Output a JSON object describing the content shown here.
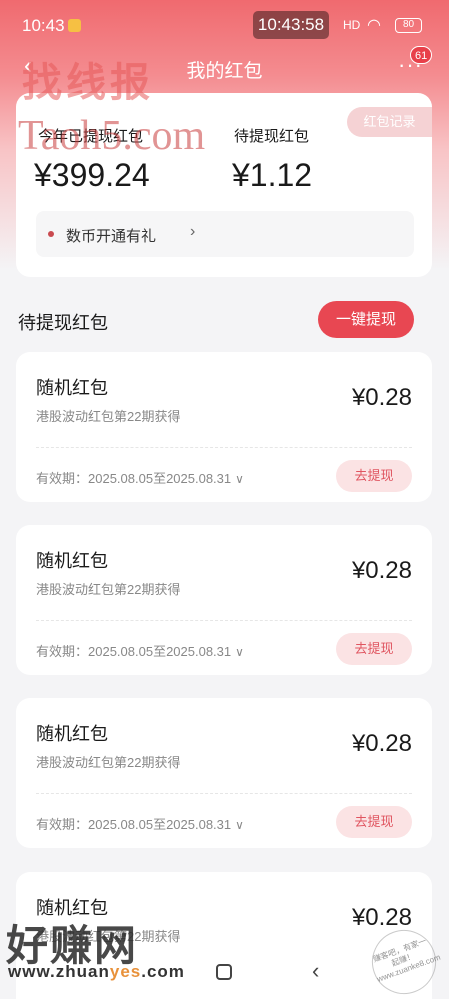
{
  "status_bar": {
    "time_left": "10:43",
    "clock": "10:43:58",
    "signal": "HD",
    "battery": "80"
  },
  "header": {
    "title": "我的红包",
    "badge_count": "61"
  },
  "summary": {
    "record_button": "红包记录",
    "withdrawn_label": "今年已提现红包",
    "withdrawn_amount": "¥399.24",
    "pending_label": "待提现红包",
    "pending_amount": "¥1.12",
    "promo_text": "数币开通有礼",
    "promo_chevron": "›"
  },
  "pending_section": {
    "title": "待提现红包",
    "one_click_button": "一键提现"
  },
  "packets": [
    {
      "title": "随机红包",
      "source": "港股波动红包第22期获得",
      "amount": "¥0.28",
      "validity": "有效期：2025.08.05至2025.08.31",
      "button": "去提现"
    },
    {
      "title": "随机红包",
      "source": "港股波动红包第22期获得",
      "amount": "¥0.28",
      "validity": "有效期：2025.08.05至2025.08.31",
      "button": "去提现"
    },
    {
      "title": "随机红包",
      "source": "港股波动红包第22期获得",
      "amount": "¥0.28",
      "validity": "有效期：2025.08.05至2025.08.31",
      "button": "去提现"
    },
    {
      "title": "随机红包",
      "source": "港股波动红包第22期获得",
      "amount": "¥0.28"
    }
  ],
  "watermarks": {
    "top_cn": "找线报",
    "top_url": "Taoh5.com",
    "bottom_cn": "好赚网",
    "bottom_url_a": "www.zhuan",
    "bottom_url_b": "yes",
    "bottom_url_c": ".com",
    "stamp": "赚客吧，有家一起赚！ www.zuanke8.com"
  },
  "colors": {
    "accent": "#e84752",
    "header_gradient_top": "#f06a6f",
    "withdraw_button_bg": "#fbe3e4"
  },
  "icons": [
    "back-arrow-icon",
    "more-icon",
    "wifi-icon",
    "signal-icon",
    "battery-icon",
    "chevron-right-icon",
    "chevron-down-icon",
    "home-key-icon",
    "back-key-icon"
  ]
}
